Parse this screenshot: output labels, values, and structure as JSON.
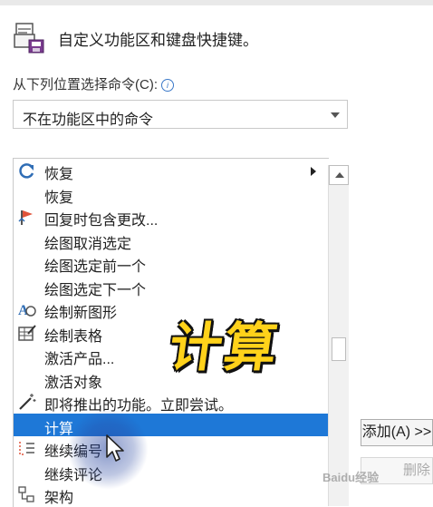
{
  "header": {
    "title": "自定义功能区和键盘快捷键。"
  },
  "choose_commands": {
    "label": "从下列位置选择命令(C):",
    "selected": "不在功能区中的命令"
  },
  "commands": [
    {
      "label": "恢复",
      "icon": "redo-icon"
    },
    {
      "label": "恢复",
      "icon": ""
    },
    {
      "label": "回复时包含更改...",
      "icon": "reply-flag-icon"
    },
    {
      "label": "绘图取消选定",
      "icon": ""
    },
    {
      "label": "绘图选定前一个",
      "icon": ""
    },
    {
      "label": "绘图选定下一个",
      "icon": ""
    },
    {
      "label": "绘制新图形",
      "icon": "draw-shape-icon"
    },
    {
      "label": "绘制表格",
      "icon": "draw-table-icon"
    },
    {
      "label": "激活产品...",
      "icon": ""
    },
    {
      "label": "激活对象",
      "icon": ""
    },
    {
      "label": "即将推出的功能。立即尝试。",
      "icon": "magic-wand-icon"
    },
    {
      "label": "计算",
      "icon": "",
      "selected": true
    },
    {
      "label": "继续编号",
      "icon": "continue-numbering-icon"
    },
    {
      "label": "继续评论",
      "icon": ""
    },
    {
      "label": "架构",
      "icon": "structure-icon"
    }
  ],
  "buttons": {
    "add": "添加(A) >>",
    "remove": "删除"
  },
  "overlay": {
    "text": "计算"
  },
  "watermark": {
    "text": "Baidu经验"
  },
  "colors": {
    "selection": "#1e78d7",
    "overlay_text": "#ffd21a"
  }
}
